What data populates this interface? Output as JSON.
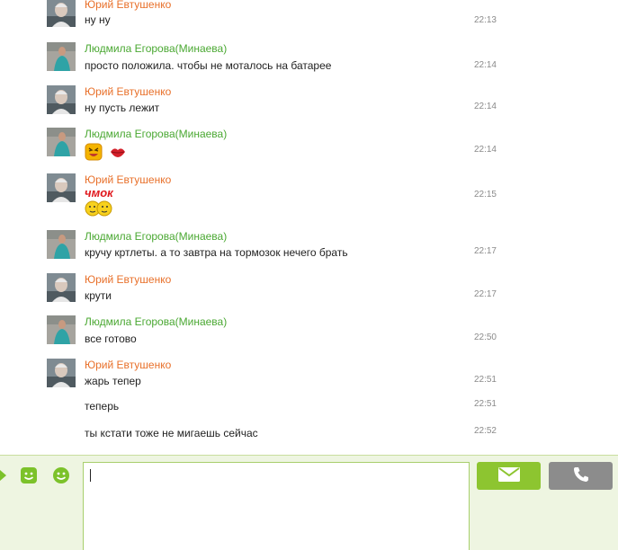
{
  "colors": {
    "yuri_name": "#e8702a",
    "lyudmila_name": "#4aa832",
    "accent": "#8dc530",
    "call_button": "#8c8c8c"
  },
  "messages": [
    {
      "author": "Юрий Евтушенко",
      "text": "ну ну",
      "time": "22:13"
    },
    {
      "author": "Людмила Егорова(Минаева)",
      "text": "просто положила. чтобы не моталось на батарее",
      "time": "22:14"
    },
    {
      "author": "Юрий Евтушенко",
      "text": "ну пусть лежит",
      "time": "22:14"
    },
    {
      "author": "Людмила Егорова(Минаева)",
      "emoticons": [
        "laughing-emoticon",
        "kiss-lips-emoticon"
      ],
      "time": "22:14"
    },
    {
      "author": "Юрий Евтушенко",
      "sticker_text": "чмок",
      "emoticons": [
        "kissing-smileys-emoticon"
      ],
      "time": "22:15"
    },
    {
      "author": "Людмила Егорова(Минаева)",
      "text": "кручу кртлеты. а то завтра на тормозок нечего брать",
      "time": "22:17"
    },
    {
      "author": "Юрий Евтушенко",
      "text": "крути",
      "time": "22:17"
    },
    {
      "author": "Людмила Егорова(Минаева)",
      "text": "все готово",
      "time": "22:50"
    },
    {
      "author": "Юрий Евтушенко",
      "text": "жарь тепер",
      "time": "22:51"
    },
    {
      "text": "теперь",
      "time": "22:51"
    },
    {
      "text": "ты кстати тоже не мигаешь сейчас",
      "time": "22:52"
    }
  ],
  "composer": {
    "input_value": "",
    "icons": [
      "expand-arrow-icon",
      "sticker-icon",
      "smiley-icon",
      "send-envelope-icon",
      "phone-call-icon"
    ]
  }
}
